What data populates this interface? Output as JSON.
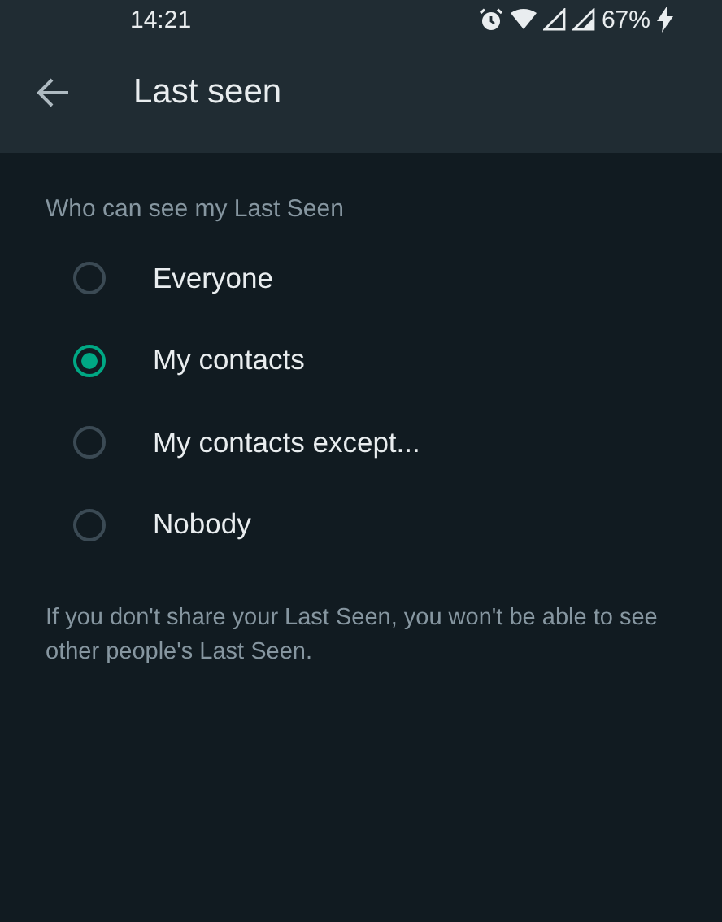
{
  "status_bar": {
    "time": "14:21",
    "battery": "67%"
  },
  "header": {
    "title": "Last seen"
  },
  "section": {
    "heading": "Who can see my Last Seen"
  },
  "options": [
    {
      "label": "Everyone",
      "selected": false
    },
    {
      "label": "My contacts",
      "selected": true
    },
    {
      "label": "My contacts except...",
      "selected": false
    },
    {
      "label": "Nobody",
      "selected": false
    }
  ],
  "footer": "If you don't share your Last Seen, you won't be able to see other people's Last Seen."
}
